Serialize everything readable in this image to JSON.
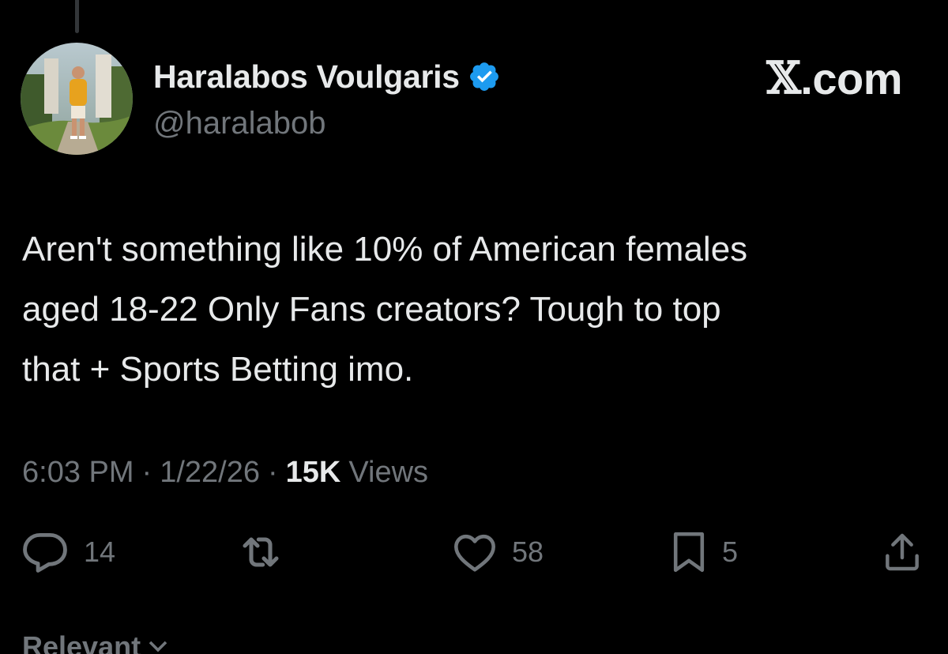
{
  "author": {
    "display_name": "Haralabos Voulgaris",
    "handle": "@haralabob",
    "verified": true,
    "avatar_icon": "profile-photo"
  },
  "brand": {
    "x_glyph": "𝕏",
    "suffix": ".com"
  },
  "tweet": {
    "lines": [
      "Aren't something like 10% of American females",
      "aged 18-22 Only Fans creators? Tough to top",
      "that + Sports Betting imo."
    ]
  },
  "meta": {
    "time": "6:03 PM",
    "separator": "·",
    "date": "1/22/26",
    "views_count": "15K",
    "views_label": "Views"
  },
  "actions": {
    "replies": "14",
    "reposts": "",
    "likes": "58",
    "bookmarks": "5"
  },
  "sort": {
    "label": "Relevant"
  },
  "colors": {
    "background": "#000000",
    "text_primary": "#e7e9ea",
    "text_secondary": "#71767b",
    "verified_badge": "#1d9bf0"
  }
}
